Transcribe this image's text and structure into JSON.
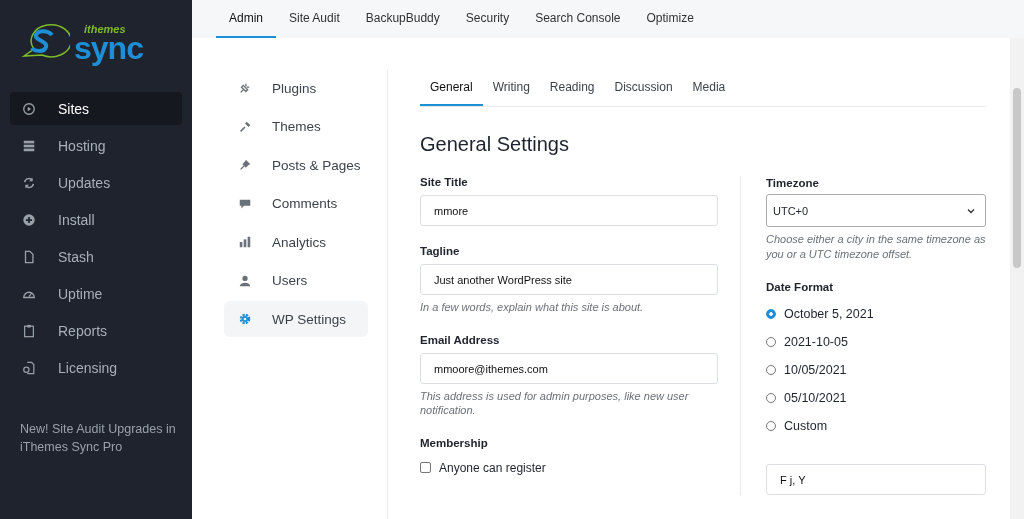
{
  "logo": {
    "small": "ithemes",
    "large": "sync"
  },
  "sidebar": {
    "items": [
      {
        "label": "Sites",
        "selected": true
      },
      {
        "label": "Hosting",
        "selected": false
      },
      {
        "label": "Updates",
        "selected": false
      },
      {
        "label": "Install",
        "selected": false
      },
      {
        "label": "Stash",
        "selected": false
      },
      {
        "label": "Uptime",
        "selected": false
      },
      {
        "label": "Reports",
        "selected": false
      },
      {
        "label": "Licensing",
        "selected": false
      }
    ],
    "promo": "New! Site Audit Upgrades in iThemes Sync Pro"
  },
  "top_tabs": [
    {
      "label": "Admin",
      "selected": true
    },
    {
      "label": "Site Audit",
      "selected": false
    },
    {
      "label": "BackupBuddy",
      "selected": false
    },
    {
      "label": "Security",
      "selected": false
    },
    {
      "label": "Search Console",
      "selected": false
    },
    {
      "label": "Optimize",
      "selected": false
    }
  ],
  "admin_menu": [
    {
      "label": "Plugins",
      "selected": false
    },
    {
      "label": "Themes",
      "selected": false
    },
    {
      "label": "Posts & Pages",
      "selected": false
    },
    {
      "label": "Comments",
      "selected": false
    },
    {
      "label": "Analytics",
      "selected": false
    },
    {
      "label": "Users",
      "selected": false
    },
    {
      "label": "WP Settings",
      "selected": true
    }
  ],
  "settings_tabs": [
    {
      "label": "General",
      "selected": true
    },
    {
      "label": "Writing",
      "selected": false
    },
    {
      "label": "Reading",
      "selected": false
    },
    {
      "label": "Discussion",
      "selected": false
    },
    {
      "label": "Media",
      "selected": false
    }
  ],
  "heading": "General Settings",
  "fields": [
    {
      "kind": "text",
      "label": "Site Title",
      "value": "mmore"
    },
    {
      "kind": "text",
      "label": "Tagline",
      "value": "Just another WordPress site",
      "hint": "In a few words, explain what this site is about."
    },
    {
      "kind": "text",
      "label": "Email Address",
      "value": "mmoore@ithemes.com",
      "hint": "This address is used for admin purposes, like new user notification."
    },
    {
      "kind": "checkbox",
      "label": "Membership",
      "option": "Anyone can register",
      "checked": false
    }
  ],
  "timezone": {
    "label": "Timezone",
    "value": "UTC+0",
    "hint": "Choose either a city in the same timezone as you or a UTC timezone offset."
  },
  "date_format": {
    "label": "Date Format",
    "options": [
      {
        "label": "October 5, 2021",
        "selected": true
      },
      {
        "label": "2021-10-05",
        "selected": false
      },
      {
        "label": "10/05/2021",
        "selected": false
      },
      {
        "label": "05/10/2021",
        "selected": false
      },
      {
        "label": "Custom",
        "selected": false
      }
    ],
    "custom_value": "F j, Y"
  }
}
